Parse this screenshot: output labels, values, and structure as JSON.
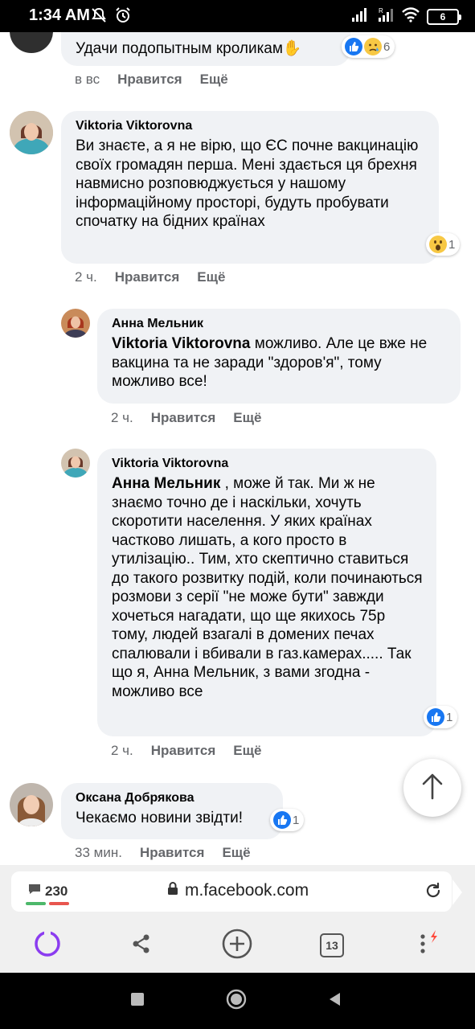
{
  "status_bar": {
    "time": "1:34 AM",
    "battery": "6"
  },
  "comments": [
    {
      "text": "Удачи подопытным кроликам✋",
      "reaction_count": "6",
      "time": "в вс",
      "like_label": "Нравится",
      "more_label": "Ещё"
    },
    {
      "author": "Viktoria Viktorovna",
      "text": "Ви знаєте, а я не вірю, що ЄС почне вакцинацію своїх громадян перша. Мені здається ця брехня навмисно розповюджується у нашому інформаційному просторі, будуть пробувати спочатку на бідних країнах",
      "reaction_count": "1",
      "time": "2 ч.",
      "like_label": "Нравится",
      "more_label": "Ещё"
    },
    {
      "author": "Анна Мельник",
      "mention": "Viktoria Viktorovna",
      "text": " можливо. Але це вже не вакцина та не заради \"здоров'я\", тому можливо все!",
      "time": "2 ч.",
      "like_label": "Нравится",
      "more_label": "Ещё"
    },
    {
      "author": "Viktoria Viktorovna",
      "mention": "Анна Мельник",
      "text": " , може й так. Ми ж не знаємо точно де і наскільки, хочуть скоротити населення. У яких країнах частково лишать, а кого просто в утилізацію.. Тим, хто скептично ставиться до такого розвитку подій, коли починаються розмови з серії \"не може бути\" завжди хочеться нагадати, що ще якихось 75р тому, людей взагалі в домених печах спалювали і вбивали в газ.камерах..... Так що я, Анна Мельник, з вами згодна - можливо все",
      "reaction_count": "1",
      "time": "2 ч.",
      "like_label": "Нравится",
      "more_label": "Ещё"
    },
    {
      "author": "Оксана Добрякова",
      "text": "Чекаємо новини звідти!",
      "reaction_count": "1",
      "time": "33 мин.",
      "like_label": "Нравится",
      "more_label": "Ещё"
    }
  ],
  "browser": {
    "comment_count": "230",
    "url": "m.facebook.com",
    "tabs_count": "13"
  },
  "colors": {
    "facebook_blue": "#1877f2",
    "bubble_bg": "#f0f2f5",
    "alice_purple": "#8b3cf0",
    "notify_red": "#ff4a3d"
  }
}
